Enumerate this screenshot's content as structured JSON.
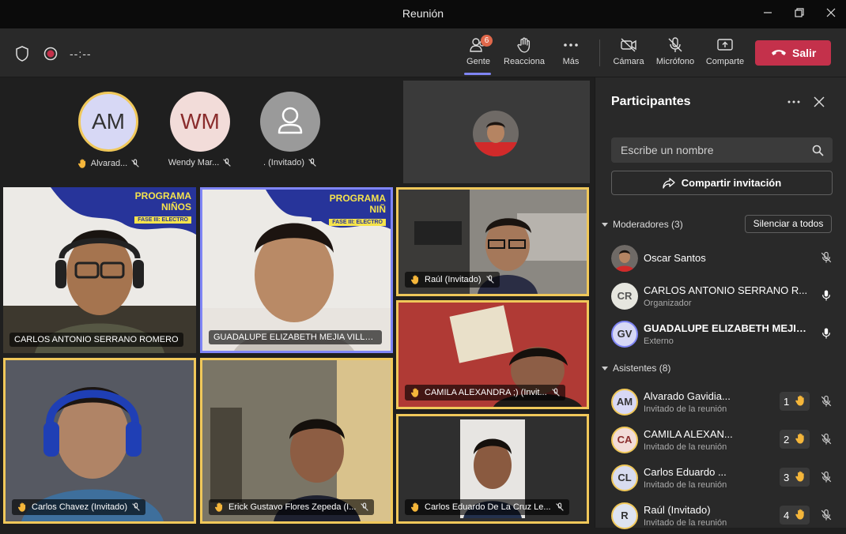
{
  "window": {
    "title": "Reunión"
  },
  "toolbar": {
    "timer": "--:--",
    "people_label": "Gente",
    "people_badge": "6",
    "react_label": "Reacciona",
    "more_label": "Más",
    "camera_label": "Cámara",
    "mic_label": "Micrófono",
    "share_label": "Comparte",
    "leave_label": "Salir"
  },
  "stage": {
    "avatar_strip": [
      {
        "initials": "AM",
        "name": "Alvarad...",
        "hand_raised": true,
        "ring_color": "#f0c85a",
        "bg": "#d7d8f5",
        "fg": "#333"
      },
      {
        "initials": "WM",
        "name": "Wendy Mar...",
        "hand_raised": false,
        "ring_color": "",
        "bg": "#f2dcd9",
        "fg": "#8a2c2c"
      },
      {
        "initials": "",
        "name": ". (Invitado)",
        "hand_raised": false,
        "ring_color": "",
        "bg": "#9a9a9a",
        "fg": "#fff"
      }
    ],
    "tiles": [
      {
        "name": "CARLOS ANTONIO SERRANO ROMERO",
        "hand_raised": false,
        "banner": "PROGRAMA NIÑOS",
        "banner_sub": "FASE III: ELECTRÓ"
      },
      {
        "name": "GUADALUPE ELIZABETH MEJIA VILLA...",
        "hand_raised": false,
        "banner": "PROGRAMA NIÑ",
        "banner_sub": "FASE III: ELECTRÓ"
      },
      {
        "name": "Raúl (Invitado)",
        "hand_raised": true
      },
      {
        "name": "CAMILA ALEXANDRA ;) (Invit...",
        "hand_raised": true
      },
      {
        "name": "Carlos Chavez (Invitado)",
        "hand_raised": true
      },
      {
        "name": "Erick Gustavo Flores Zepeda (I...",
        "hand_raised": true
      },
      {
        "name": "Carlos Eduardo De La Cruz Le...",
        "hand_raised": true
      }
    ]
  },
  "panel": {
    "title": "Participantes",
    "search_placeholder": "Escribe un nombre",
    "share_invite": "Compartir invitación",
    "moderators_header": "Moderadores (3)",
    "mute_all": "Silenciar a todos",
    "attendees_header": "Asistentes (8)",
    "moderators": [
      {
        "name": "Oscar Santos",
        "role": "",
        "initials": "",
        "mic": "muted",
        "bold": false
      },
      {
        "name": "CARLOS ANTONIO SERRANO R...",
        "role": "Organizador",
        "initials": "CR",
        "mic": "on",
        "bold": false
      },
      {
        "name": "GUADALUPE ELIZABETH MEJIA ...",
        "role": "Externo",
        "initials": "GV",
        "mic": "on",
        "bold": true
      }
    ],
    "attendees": [
      {
        "name": "Alvarado Gavidia...",
        "role": "Invitado de la reunión",
        "initials": "AM",
        "hand_order": "1"
      },
      {
        "name": "CAMILA ALEXAN...",
        "role": "Invitado de la reunión",
        "initials": "CA",
        "hand_order": "2"
      },
      {
        "name": "Carlos Eduardo ...",
        "role": "Invitado de la reunión",
        "initials": "CL",
        "hand_order": "3"
      },
      {
        "name": "Raúl (Invitado)",
        "role": "Invitado de la reunión",
        "initials": "R",
        "hand_order": "4"
      }
    ]
  },
  "colors": {
    "accent": "#7f85f5",
    "leave": "#c4314b",
    "raised_hand": "#f0c85a",
    "hand_icon": "#f5b63a"
  }
}
